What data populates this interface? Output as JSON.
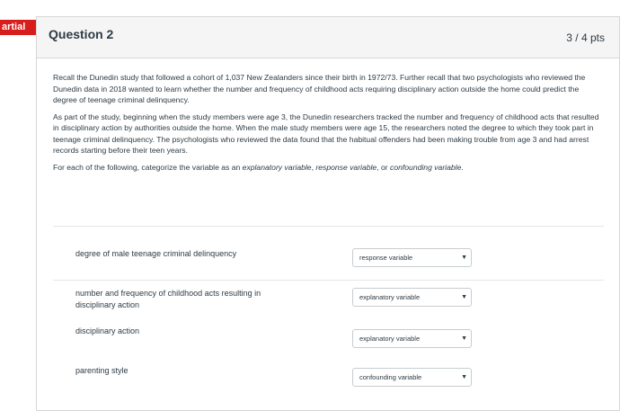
{
  "status_ribbon": "artial",
  "question": {
    "title": "Question 2",
    "points": "3 / 4 pts",
    "paragraph1": "Recall the Dunedin study that followed a cohort of 1,037 New Zealanders since their birth in 1972/73. Further recall that two psychologists who reviewed the Dunedin data in 2018 wanted to learn whether the number and frequency of childhood acts requiring disciplinary action outside the home could predict the degree of teenage criminal delinquency.",
    "paragraph2": "As part of the study, beginning when the study members were age 3, the Dunedin researchers tracked the number and frequency of childhood acts that resulted in disciplinary action by authorities outside the home. When the male study members were age 15, the researchers noted the degree to which they took part in teenage criminal delinquency. The psychologists who reviewed the data found that the habitual offenders had been making trouble from age 3 and had arrest records starting before their teen years.",
    "instruction_prefix": "For each of the following, categorize the variable as an ",
    "instruction_em1": "explanatory variable",
    "instruction_sep1": ", ",
    "instruction_em2": "response variable",
    "instruction_sep2": ", or ",
    "instruction_em3": "confounding variable",
    "instruction_suffix": "."
  },
  "rows": [
    {
      "label": "degree of male teenage criminal delinquency",
      "selected": "response variable"
    },
    {
      "label": "number and frequency of childhood acts resulting in disciplinary action",
      "selected": "explanatory variable"
    },
    {
      "label": "disciplinary action",
      "selected": "explanatory variable"
    },
    {
      "label": "parenting style",
      "selected": "confounding variable"
    }
  ],
  "icons": {
    "dropdown": "chevron-down-icon"
  },
  "colors": {
    "ribbon": "#d81d1d",
    "text": "#2d3b45"
  }
}
